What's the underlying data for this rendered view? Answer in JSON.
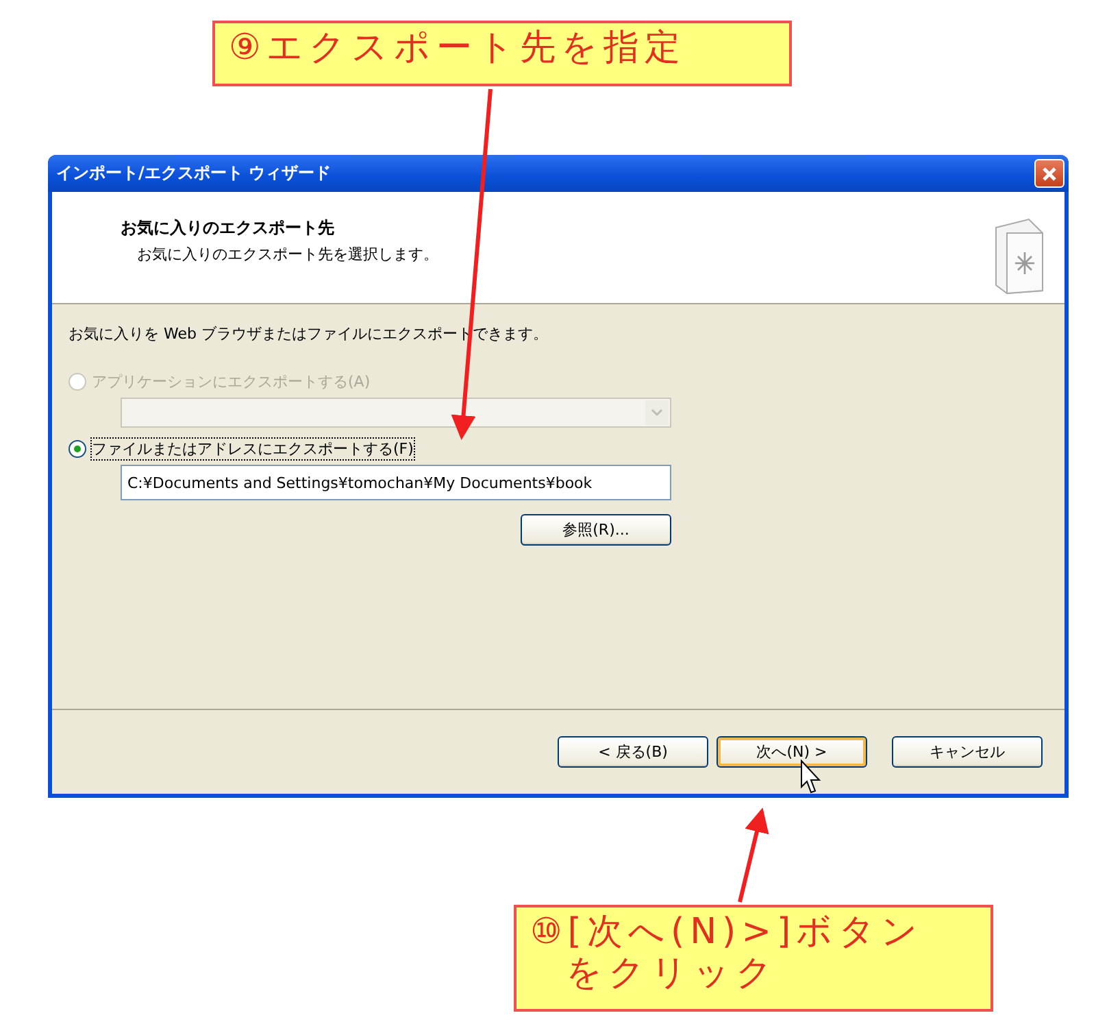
{
  "callouts": [
    {
      "lines": [
        "⑨エクスポート先を指定"
      ]
    },
    {
      "lines": [
        "⑩[次へ(N)>]ボタン",
        "をクリック"
      ]
    }
  ],
  "window": {
    "title": "インポート/エクスポート ウィザード"
  },
  "header": {
    "title": "お気に入りのエクスポート先",
    "subtitle": "お気に入りのエクスポート先を選択します。"
  },
  "intro": "お気に入りを Web ブラウザまたはファイルにエクスポートできます。",
  "options": [
    {
      "label": "アプリケーションにエクスポートする(A)",
      "selected": false,
      "disabled": true,
      "kind": "combo"
    },
    {
      "label": "ファイルまたはアドレスにエクスポートする(F)",
      "selected": true,
      "disabled": false,
      "kind": "path",
      "value": "C:¥Documents and Settings¥tomochan¥My Documents¥book",
      "browse": "参照(R)..."
    }
  ],
  "buttons": [
    {
      "label": "< 戻る(B)",
      "focused": false
    },
    {
      "label": "次へ(N) >",
      "focused": true
    },
    {
      "label": "キャンセル",
      "focused": false
    }
  ]
}
